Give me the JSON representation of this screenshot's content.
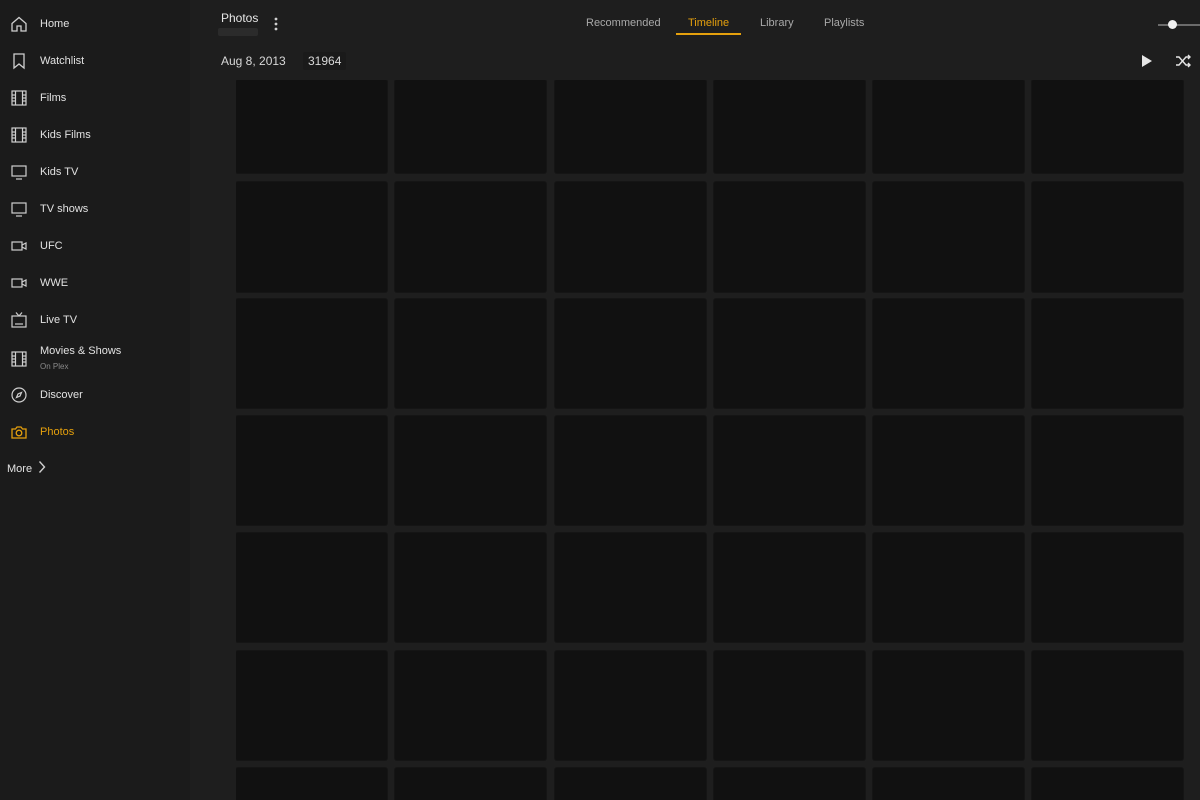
{
  "sidebar": {
    "items": [
      {
        "label": "Home",
        "icon": "home-icon",
        "active": false
      },
      {
        "label": "Watchlist",
        "icon": "bookmark-icon",
        "active": false
      },
      {
        "label": "Films",
        "icon": "film-icon",
        "active": false
      },
      {
        "label": "Kids Films",
        "icon": "film-icon",
        "active": false
      },
      {
        "label": "Kids TV",
        "icon": "tv-icon",
        "active": false
      },
      {
        "label": "TV shows",
        "icon": "tv-icon",
        "active": false
      },
      {
        "label": "UFC",
        "icon": "video-camera-icon",
        "active": false
      },
      {
        "label": "WWE",
        "icon": "video-camera-icon",
        "active": false
      },
      {
        "label": "Live TV",
        "icon": "live-tv-icon",
        "active": false
      },
      {
        "label": "Movies & Shows",
        "sublabel": "On Plex",
        "icon": "film-icon",
        "active": false
      },
      {
        "label": "Discover",
        "icon": "compass-icon",
        "active": false
      },
      {
        "label": "Photos",
        "icon": "camera-icon",
        "active": true
      }
    ],
    "more_label": "More"
  },
  "header": {
    "library_title": "Photos",
    "tabs": [
      {
        "label": "Recommended",
        "active": false
      },
      {
        "label": "Timeline",
        "active": true
      },
      {
        "label": "Library",
        "active": false
      },
      {
        "label": "Playlists",
        "active": false
      }
    ]
  },
  "subheader": {
    "date": "Aug 8, 2013",
    "count": "31964"
  },
  "colors": {
    "accent": "#e5a00d",
    "background": "#1e1e1e",
    "sidebar": "#1b1b1b",
    "tile": "#111111"
  },
  "grid": {
    "columns": 6,
    "rows": 7
  }
}
